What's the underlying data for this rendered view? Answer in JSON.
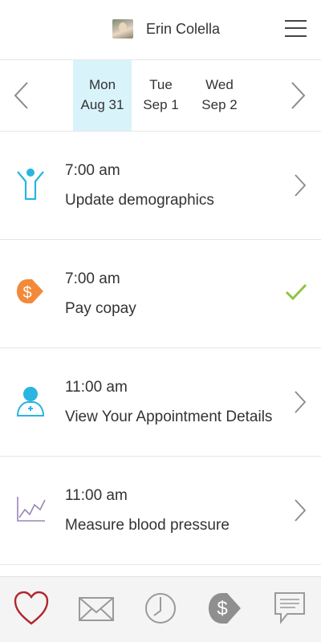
{
  "header": {
    "user_name": "Erin Colella",
    "menu_icon": "hamburger-menu-icon"
  },
  "date_nav": {
    "prev_icon": "chevron-left-icon",
    "next_icon": "chevron-right-icon",
    "days": [
      {
        "day": "Mon",
        "date": "Aug 31",
        "selected": true
      },
      {
        "day": "Tue",
        "date": "Sep 1",
        "selected": false
      },
      {
        "day": "Wed",
        "date": "Sep 2",
        "selected": false
      }
    ],
    "selected_color": "#d9f3fb"
  },
  "tasks": [
    {
      "time": "7:00 am",
      "title": "Update demographics",
      "icon": "person-icon",
      "status": "open"
    },
    {
      "time": "7:00 am",
      "title": "Pay copay",
      "icon": "dollar-tag-icon",
      "status": "done"
    },
    {
      "time": "11:00 am",
      "title": "View Your Appointment Details",
      "icon": "doctor-icon",
      "status": "open"
    },
    {
      "time": "11:00 am",
      "title": "Measure blood pressure",
      "icon": "chart-line-icon",
      "status": "open"
    }
  ],
  "tabbar": {
    "tabs": [
      "heart-icon",
      "mail-icon",
      "clock-icon",
      "dollar-tag-icon",
      "chat-icon"
    ],
    "active": "heart-icon"
  },
  "colors": {
    "accent_blue": "#29b5e0",
    "copay_orange": "#f28a3a",
    "check_green": "#8cc63f",
    "bp_purple": "#9b86b8",
    "heart_red": "#b3262d"
  }
}
